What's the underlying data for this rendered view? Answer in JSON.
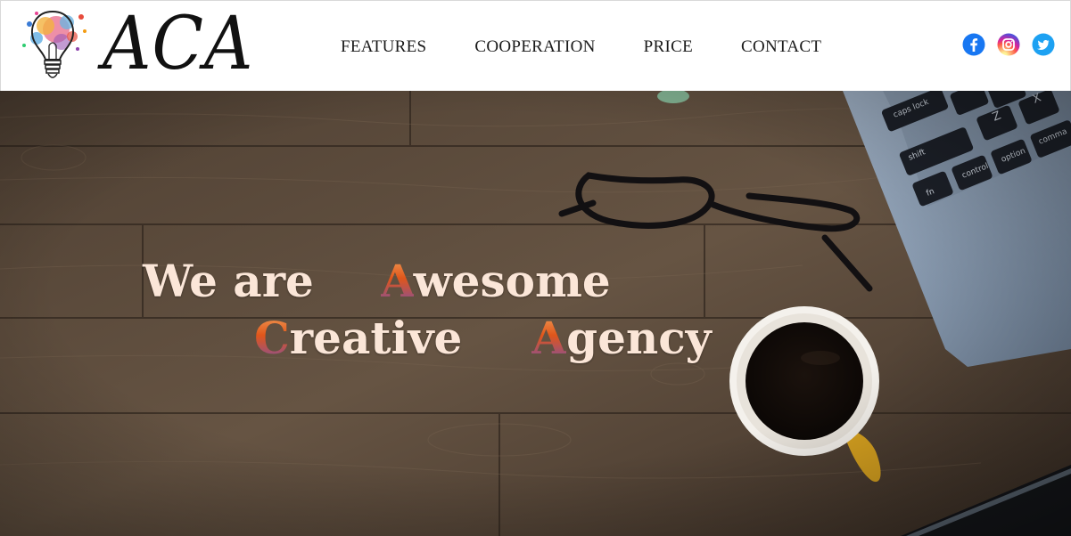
{
  "header": {
    "logo_text": "ACA",
    "logo_icon": "lightbulb-splash-icon"
  },
  "nav": [
    {
      "label": "FEATURES"
    },
    {
      "label": "COOPERATION"
    },
    {
      "label": "PRICE"
    },
    {
      "label": "CONTACT"
    }
  ],
  "social": [
    {
      "icon": "facebook-icon",
      "color": "#1877f2"
    },
    {
      "icon": "instagram-icon",
      "color": "#d6249f"
    },
    {
      "icon": "twitter-icon",
      "color": "#1da1f2"
    }
  ],
  "hero": {
    "line1_pre": "We are",
    "line1_cap": "A",
    "line1_rest": "wesome",
    "line2_cap1": "C",
    "line2_rest1": "reative",
    "line2_cap2": "A",
    "line2_rest2": "gency",
    "text_color": "#fbe6d8",
    "accent_color": "#e0561a",
    "background": "wooden-desk-with-glasses-coffee-laptop"
  }
}
